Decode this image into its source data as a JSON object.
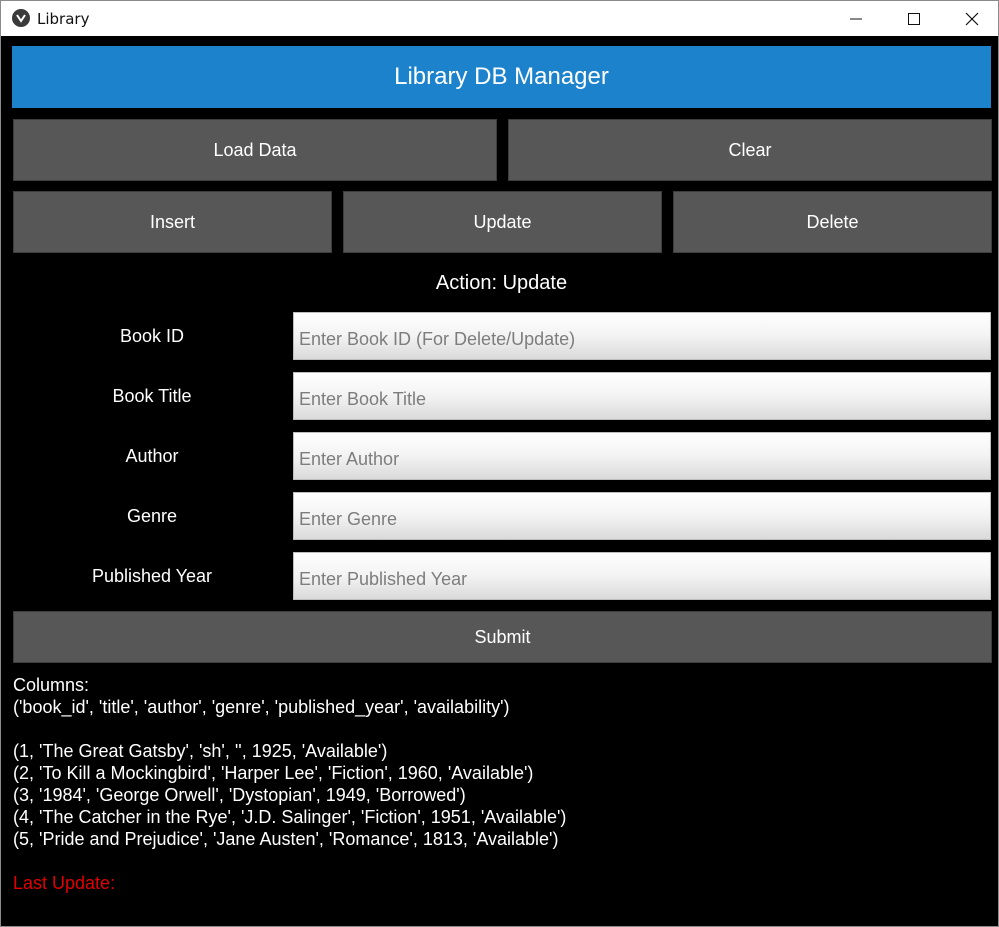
{
  "window": {
    "title": "Library",
    "icons": {
      "app": "kivy-app-icon",
      "minimize": "minimize-icon",
      "maximize": "maximize-icon",
      "close": "close-icon"
    }
  },
  "header": {
    "title": "Library DB Manager"
  },
  "toolbar": {
    "load_label": "Load Data",
    "clear_label": "Clear",
    "insert_label": "Insert",
    "update_label": "Update",
    "delete_label": "Delete"
  },
  "action": {
    "text": "Action: Update"
  },
  "form": {
    "book_id": {
      "label": "Book ID",
      "placeholder": "Enter Book ID (For Delete/Update)",
      "value": ""
    },
    "title": {
      "label": "Book Title",
      "placeholder": "Enter Book Title",
      "value": ""
    },
    "author": {
      "label": "Author",
      "placeholder": "Enter Author",
      "value": ""
    },
    "genre": {
      "label": "Genre",
      "placeholder": "Enter Genre",
      "value": ""
    },
    "year": {
      "label": "Published Year",
      "placeholder": "Enter Published Year",
      "value": ""
    },
    "submit_label": "Submit"
  },
  "output": {
    "columns_heading": "Columns:",
    "columns": "('book_id', 'title', 'author', 'genre', 'published_year', 'availability')",
    "rows": [
      "(1, 'The Great Gatsby', 'sh', '', 1925, 'Available')",
      "(2, 'To Kill a Mockingbird', 'Harper Lee', 'Fiction', 1960, 'Available')",
      "(3, '1984', 'George Orwell', 'Dystopian', 1949, 'Borrowed')",
      "(4, 'The Catcher in the Rye', 'J.D. Salinger', 'Fiction', 1951, 'Available')",
      "(5, 'Pride and Prejudice', 'Jane Austen', 'Romance', 1813, 'Available')"
    ],
    "last_update": "Last Update:"
  },
  "colors": {
    "header": "#1c82cc",
    "button": "#575757",
    "background": "#000000",
    "last_update": "#e30000"
  }
}
